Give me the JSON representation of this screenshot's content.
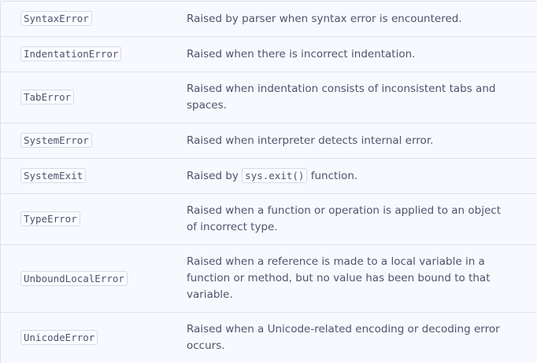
{
  "rows": [
    {
      "name": "SyntaxError",
      "desc": "Raised by parser when syntax error is encountered."
    },
    {
      "name": "IndentationError",
      "desc": "Raised when there is incorrect indentation."
    },
    {
      "name": "TabError",
      "desc": "Raised when indentation consists of inconsistent tabs and spaces."
    },
    {
      "name": "SystemError",
      "desc": "Raised when interpreter detects internal error."
    },
    {
      "name": "SystemExit",
      "desc_pre": "Raised by",
      "desc_code": "sys.exit()",
      "desc_post": "function."
    },
    {
      "name": "TypeError",
      "desc": "Raised when a function or operation is applied to an object of incorrect type."
    },
    {
      "name": "UnboundLocalError",
      "desc": "Raised when a reference is made to a local variable in a function or method, but no value has been bound to that variable."
    },
    {
      "name": "UnicodeError",
      "desc": "Raised when a Unicode-related encoding or decoding error occurs."
    }
  ]
}
